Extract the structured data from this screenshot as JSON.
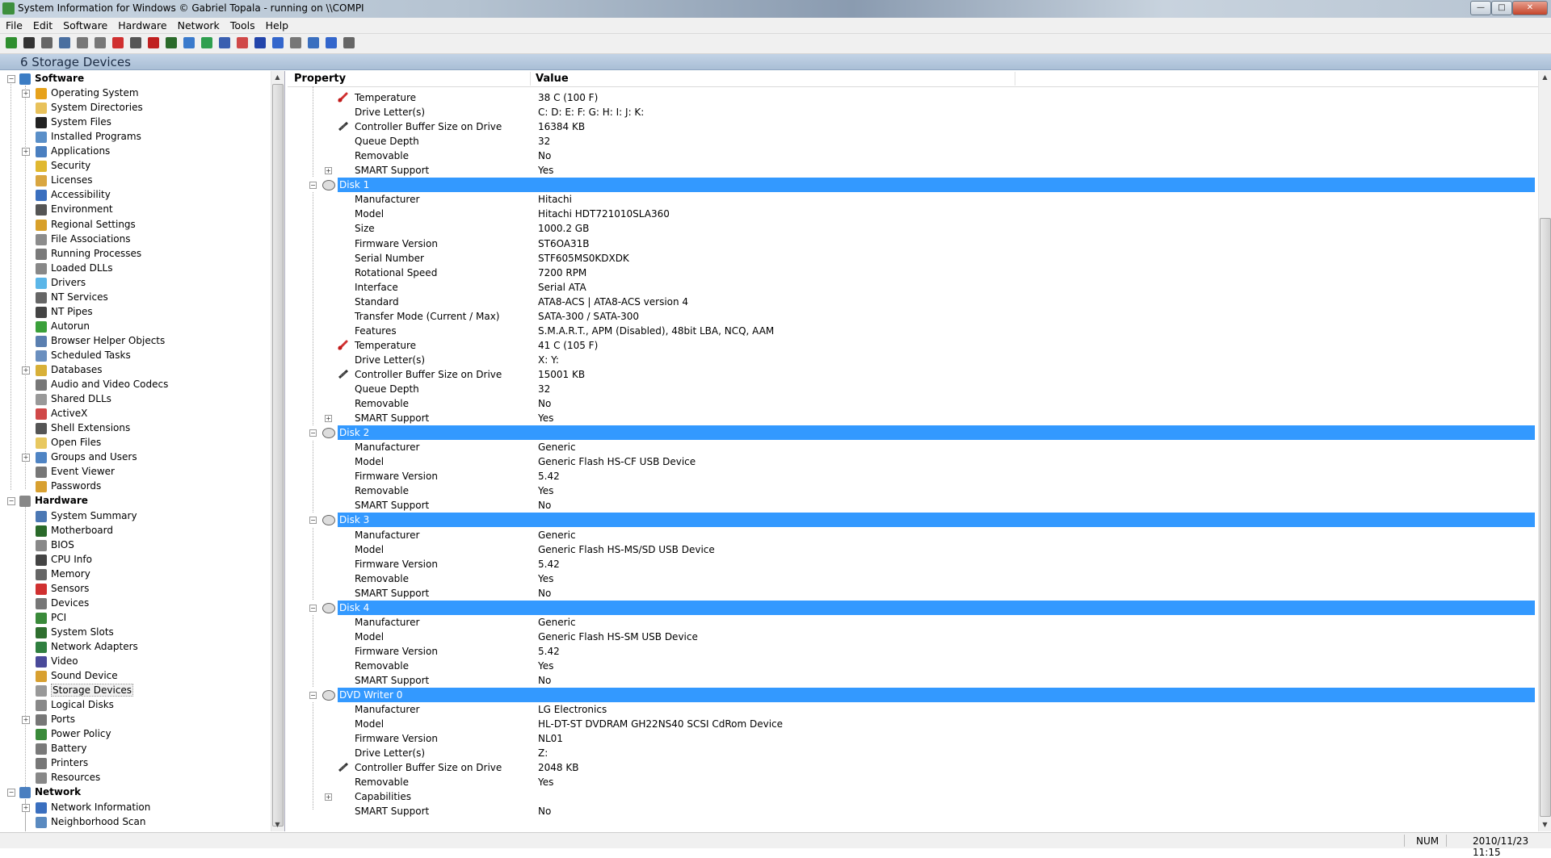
{
  "window": {
    "title": "System Information for Windows  © Gabriel Topala - running on \\\\COMPI",
    "minimize": "—",
    "maximize": "□",
    "close": "✕"
  },
  "menu": [
    "File",
    "Edit",
    "Software",
    "Hardware",
    "Network",
    "Tools",
    "Help"
  ],
  "toolbar_icons": [
    "import-icon",
    "save-icon",
    "cut-icon",
    "copy-icon",
    "paste-icon",
    "print-icon",
    "stop-icon",
    "find-icon",
    "chart-icon",
    "graph-icon",
    "network-icon",
    "refresh-icon",
    "report-icon",
    "office-icon",
    "shield-icon",
    "ie-icon",
    "settings-icon",
    "web-icon",
    "help-icon",
    "about-icon"
  ],
  "header": {
    "title": "6 Storage Devices"
  },
  "tree": [
    {
      "label": "Software",
      "level": 0,
      "cat": true,
      "exp": "-",
      "color": "#3c7dc4"
    },
    {
      "label": "Operating System",
      "level": 1,
      "exp": "+",
      "color": "#e7a21b"
    },
    {
      "label": "System Directories",
      "level": 1,
      "color": "#e8c15a"
    },
    {
      "label": "System Files",
      "level": 1,
      "color": "#222222"
    },
    {
      "label": "Installed Programs",
      "level": 1,
      "color": "#5a8fc8"
    },
    {
      "label": "Applications",
      "level": 1,
      "exp": "+",
      "color": "#4a7fc0"
    },
    {
      "label": "Security",
      "level": 1,
      "color": "#e0b830"
    },
    {
      "label": "Licenses",
      "level": 1,
      "color": "#d9a640"
    },
    {
      "label": "Accessibility",
      "level": 1,
      "color": "#3a6fbf"
    },
    {
      "label": "Environment",
      "level": 1,
      "color": "#555555"
    },
    {
      "label": "Regional Settings",
      "level": 1,
      "color": "#d8a02a"
    },
    {
      "label": "File Associations",
      "level": 1,
      "color": "#8c8c8c"
    },
    {
      "label": "Running Processes",
      "level": 1,
      "color": "#7a7a7a"
    },
    {
      "label": "Loaded DLLs",
      "level": 1,
      "color": "#888888"
    },
    {
      "label": "Drivers",
      "level": 1,
      "color": "#5bb6e8"
    },
    {
      "label": "NT Services",
      "level": 1,
      "color": "#666666"
    },
    {
      "label": "NT Pipes",
      "level": 1,
      "color": "#444444"
    },
    {
      "label": "Autorun",
      "level": 1,
      "color": "#3aa03a"
    },
    {
      "label": "Browser Helper Objects",
      "level": 1,
      "color": "#5a7fb0"
    },
    {
      "label": "Scheduled Tasks",
      "level": 1,
      "color": "#6a8fbf"
    },
    {
      "label": "Databases",
      "level": 1,
      "exp": "+",
      "color": "#d8b038"
    },
    {
      "label": "Audio and Video Codecs",
      "level": 1,
      "color": "#777777"
    },
    {
      "label": "Shared DLLs",
      "level": 1,
      "color": "#999999"
    },
    {
      "label": "ActiveX",
      "level": 1,
      "color": "#d04848"
    },
    {
      "label": "Shell Extensions",
      "level": 1,
      "color": "#555555"
    },
    {
      "label": "Open Files",
      "level": 1,
      "color": "#e8c860"
    },
    {
      "label": "Groups and Users",
      "level": 1,
      "exp": "+",
      "color": "#4f84c4"
    },
    {
      "label": "Event Viewer",
      "level": 1,
      "color": "#777777"
    },
    {
      "label": "Passwords",
      "level": 1,
      "color": "#d8a030"
    },
    {
      "label": "Hardware",
      "level": 0,
      "cat": true,
      "exp": "-",
      "color": "#888888"
    },
    {
      "label": "System Summary",
      "level": 1,
      "color": "#4b78b4"
    },
    {
      "label": "Motherboard",
      "level": 1,
      "color": "#2a6a2a"
    },
    {
      "label": "BIOS",
      "level": 1,
      "color": "#888888"
    },
    {
      "label": "CPU Info",
      "level": 1,
      "color": "#444444"
    },
    {
      "label": "Memory",
      "level": 1,
      "color": "#666666"
    },
    {
      "label": "Sensors",
      "level": 1,
      "color": "#d03030"
    },
    {
      "label": "Devices",
      "level": 1,
      "color": "#777777"
    },
    {
      "label": "PCI",
      "level": 1,
      "color": "#3a8a3a"
    },
    {
      "label": "System Slots",
      "level": 1,
      "color": "#2f6f2f"
    },
    {
      "label": "Network Adapters",
      "level": 1,
      "color": "#2f7f3f"
    },
    {
      "label": "Video",
      "level": 1,
      "color": "#4a4a9a"
    },
    {
      "label": "Sound Device",
      "level": 1,
      "color": "#d8a030"
    },
    {
      "label": "Storage Devices",
      "level": 1,
      "color": "#999999",
      "selected": true
    },
    {
      "label": "Logical Disks",
      "level": 1,
      "color": "#888888"
    },
    {
      "label": "Ports",
      "level": 1,
      "exp": "+",
      "color": "#777777"
    },
    {
      "label": "Power Policy",
      "level": 1,
      "color": "#3a8a3a"
    },
    {
      "label": "Battery",
      "level": 1,
      "color": "#7a7a7a"
    },
    {
      "label": "Printers",
      "level": 1,
      "color": "#777777"
    },
    {
      "label": "Resources",
      "level": 1,
      "color": "#888888"
    },
    {
      "label": "Network",
      "level": 0,
      "cat": true,
      "exp": "-",
      "color": "#4a7fc0"
    },
    {
      "label": "Network Information",
      "level": 1,
      "exp": "+",
      "color": "#3a6fbf"
    },
    {
      "label": "Neighborhood Scan",
      "level": 1,
      "color": "#5a8ac0"
    }
  ],
  "columns": {
    "property": "Property",
    "value": "Value"
  },
  "properties": [
    {
      "k": "Temperature",
      "v": "38 C (100 F)",
      "icon": "thermometer-icon"
    },
    {
      "k": "Drive Letter(s)",
      "v": "C: D: E: F: G: H: I: J: K:"
    },
    {
      "k": "Controller Buffer Size on Drive",
      "v": "16384 KB",
      "icon": "buffer-icon"
    },
    {
      "k": "Queue Depth",
      "v": "32"
    },
    {
      "k": "Removable",
      "v": "No"
    },
    {
      "k": "SMART Support",
      "v": "Yes",
      "exp": "+"
    },
    {
      "group": "Disk 1"
    },
    {
      "k": "Manufacturer",
      "v": "Hitachi"
    },
    {
      "k": "Model",
      "v": "Hitachi HDT721010SLA360"
    },
    {
      "k": "Size",
      "v": "1000.2 GB"
    },
    {
      "k": "Firmware Version",
      "v": "ST6OA31B"
    },
    {
      "k": "Serial Number",
      "v": "STF605MS0KDXDK"
    },
    {
      "k": "Rotational Speed",
      "v": "7200 RPM"
    },
    {
      "k": "Interface",
      "v": "Serial ATA"
    },
    {
      "k": "Standard",
      "v": "ATA8-ACS | ATA8-ACS version 4"
    },
    {
      "k": "Transfer Mode (Current / Max)",
      "v": "SATA-300 / SATA-300"
    },
    {
      "k": "Features",
      "v": "S.M.A.R.T., APM (Disabled), 48bit LBA, NCQ, AAM"
    },
    {
      "k": "Temperature",
      "v": "41 C (105 F)",
      "icon": "thermometer-icon"
    },
    {
      "k": "Drive Letter(s)",
      "v": "X: Y:"
    },
    {
      "k": "Controller Buffer Size on Drive",
      "v": "15001 KB",
      "icon": "buffer-icon"
    },
    {
      "k": "Queue Depth",
      "v": "32"
    },
    {
      "k": "Removable",
      "v": "No"
    },
    {
      "k": "SMART Support",
      "v": "Yes",
      "exp": "+"
    },
    {
      "group": "Disk 2"
    },
    {
      "k": "Manufacturer",
      "v": "Generic"
    },
    {
      "k": "Model",
      "v": "Generic Flash HS-CF USB Device"
    },
    {
      "k": "Firmware Version",
      "v": "5.42"
    },
    {
      "k": "Removable",
      "v": "Yes"
    },
    {
      "k": "SMART Support",
      "v": "No"
    },
    {
      "group": "Disk 3"
    },
    {
      "k": "Manufacturer",
      "v": "Generic"
    },
    {
      "k": "Model",
      "v": "Generic Flash HS-MS/SD USB Device"
    },
    {
      "k": "Firmware Version",
      "v": "5.42"
    },
    {
      "k": "Removable",
      "v": "Yes"
    },
    {
      "k": "SMART Support",
      "v": "No"
    },
    {
      "group": "Disk 4"
    },
    {
      "k": "Manufacturer",
      "v": "Generic"
    },
    {
      "k": "Model",
      "v": "Generic Flash HS-SM USB Device"
    },
    {
      "k": "Firmware Version",
      "v": "5.42"
    },
    {
      "k": "Removable",
      "v": "Yes"
    },
    {
      "k": "SMART Support",
      "v": "No"
    },
    {
      "group": "DVD Writer 0"
    },
    {
      "k": "Manufacturer",
      "v": "LG Electronics"
    },
    {
      "k": "Model",
      "v": "HL-DT-ST DVDRAM GH22NS40 SCSI CdRom Device"
    },
    {
      "k": "Firmware Version",
      "v": "NL01"
    },
    {
      "k": "Drive Letter(s)",
      "v": "Z:"
    },
    {
      "k": "Controller Buffer Size on Drive",
      "v": "2048 KB",
      "icon": "buffer-icon"
    },
    {
      "k": "Removable",
      "v": "Yes"
    },
    {
      "k": "Capabilities",
      "v": "",
      "exp": "+"
    },
    {
      "k": "SMART Support",
      "v": "No"
    }
  ],
  "status": {
    "num": "NUM",
    "datetime": "2010/11/23 11:15"
  }
}
